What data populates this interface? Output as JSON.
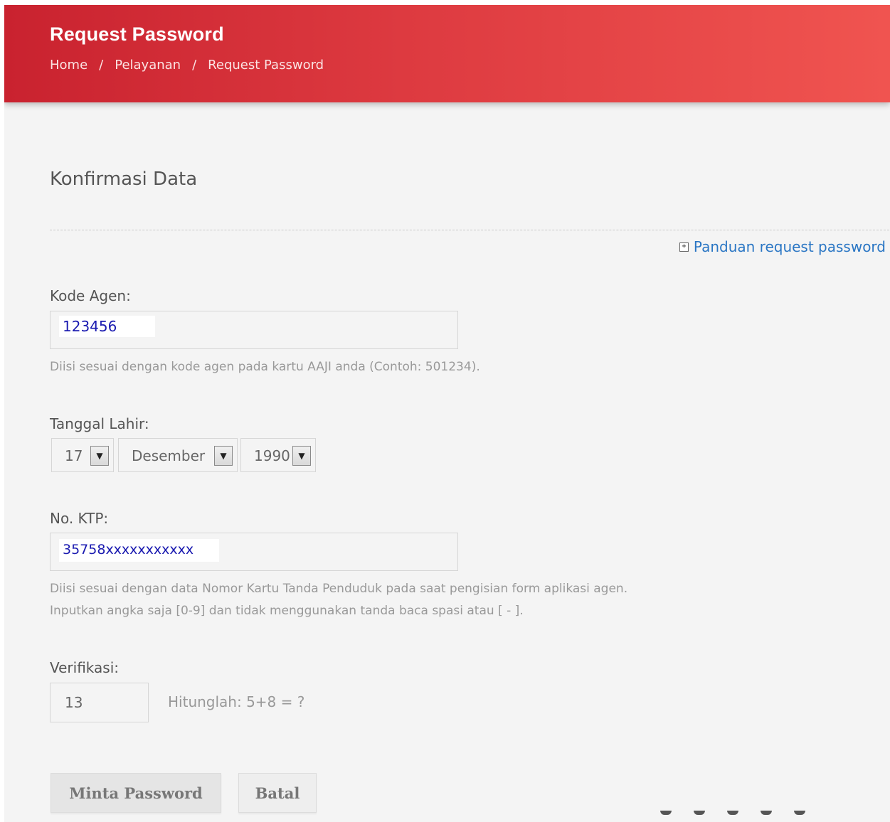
{
  "header": {
    "title": "Request Password",
    "breadcrumb": [
      "Home",
      "Pelayanan",
      "Request Password"
    ],
    "separator": "/"
  },
  "section": {
    "title": "Konfirmasi Data",
    "guide_link": "Panduan request password",
    "guide_icon": "plus-box-icon"
  },
  "fields": {
    "kode_agen": {
      "label": "Kode Agen:",
      "value": "123456",
      "help": "Diisi sesuai dengan kode agen pada kartu AAJI anda (Contoh: 501234)."
    },
    "tanggal_lahir": {
      "label": "Tanggal Lahir:",
      "day": "17",
      "month": "Desember",
      "year": "1990"
    },
    "ktp": {
      "label": "No. KTP:",
      "value": "35758xxxxxxxxxxx",
      "help_line1": "Diisi sesuai dengan data Nomor Kartu Tanda Penduduk pada saat pengisian form aplikasi agen.",
      "help_line2": "Inputkan angka saja [0-9] dan tidak menggunakan tanda baca spasi atau [ - ]."
    },
    "verifikasi": {
      "label": "Verifikasi:",
      "value": "13",
      "question": "Hitunglah:  5+8 = ?"
    }
  },
  "buttons": {
    "submit": "Minta Password",
    "cancel": "Batal"
  },
  "colors": {
    "header_start": "#c9222f",
    "header_end": "#f05450",
    "link": "#2a76c4",
    "input_value": "#1a1ab0"
  }
}
